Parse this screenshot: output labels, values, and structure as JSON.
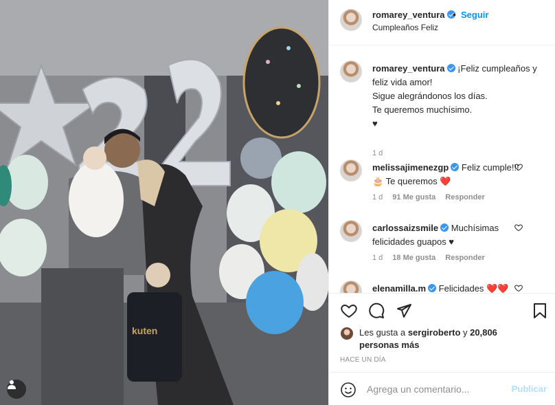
{
  "header": {
    "username": "romarey_ventura",
    "separator": "•",
    "follow_label": "Seguir",
    "location": "Cumpleaños Feliz"
  },
  "caption": {
    "username": "romarey_ventura",
    "text": "¡Feliz cumpleaños y feliz vida amor!\nSigue alegrándonos los días.\nTe queremos muchísimo.\n♥",
    "time": "1 d"
  },
  "comments": [
    {
      "username": "melissajimenezgp",
      "text": "Feliz cumple!!! 🎂 Te queremos ❤️",
      "time": "1 d",
      "likes": "91 Me gusta",
      "reply": "Responder"
    },
    {
      "username": "carlossaizsmile",
      "text": "Muchísimas felicidades guapos ♥",
      "time": "1 d",
      "likes": "18 Me gusta",
      "reply": "Responder"
    },
    {
      "username": "elenamilla.m",
      "text": "Felicidades ❤️❤️",
      "time": "",
      "likes": "",
      "reply": ""
    }
  ],
  "actions": {
    "like_icon": "heart-icon",
    "comment_icon": "comment-icon",
    "share_icon": "share-icon",
    "save_icon": "bookmark-icon"
  },
  "likes": {
    "prefix": "Les gusta a ",
    "user": "sergiroberto",
    "middle": " y ",
    "count": "20,806 personas más"
  },
  "posted": "HACE UN DÍA",
  "add_comment": {
    "placeholder": "Agrega un comentario...",
    "publish_label": "Publicar"
  },
  "colors": {
    "link_blue": "#0095f6",
    "verified_blue": "#3897f0",
    "publish_disabled": "#b2dffc",
    "muted": "#8e8e8e"
  }
}
